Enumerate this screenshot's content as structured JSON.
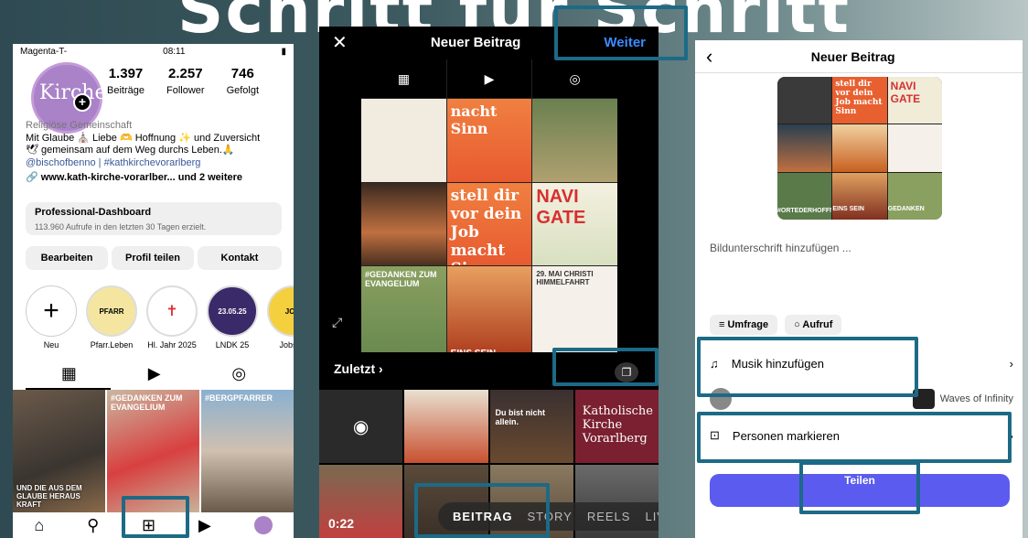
{
  "title": "Schritt für Schritt",
  "colors": {
    "highlight": "#1c6a86",
    "accent": "#3d8bff",
    "share": "#5b5bf0"
  },
  "profile": {
    "status": {
      "carrier": "Magenta-T-",
      "time": "08:11"
    },
    "avatar_text": "Kirche",
    "stats": [
      {
        "value": "1.397",
        "label": "Beiträge"
      },
      {
        "value": "2.257",
        "label": "Follower"
      },
      {
        "value": "746",
        "label": "Gefolgt"
      }
    ],
    "category": "Religiöse Gemeinschaft",
    "bio_line1": "Mit Glaube ⛪ Liebe 🫶 Hoffnung ✨ und Zuversicht",
    "bio_line2": "🕊 gemeinsam auf dem Weg durchs Leben.🙏",
    "mentions": "@bischofbenno | #kathkirchevorarlberg",
    "website": "🔗 www.kath-kirche-vorarlber... und 2 weitere",
    "dashboard_title": "Professional-Dashboard",
    "dashboard_sub": "113.960 Aufrufe in den letzten 30 Tagen erzielt.",
    "buttons": [
      "Bearbeiten",
      "Profil teilen",
      "Kontakt"
    ],
    "highlights": [
      {
        "label": "Neu",
        "text": "+"
      },
      {
        "label": "Pfarr.Leben",
        "text": "PFARR"
      },
      {
        "label": "Hl. Jahr 2025",
        "text": ""
      },
      {
        "label": "LNDK 25",
        "text": "23.05.25"
      },
      {
        "label": "Jobs m",
        "text": "JOB"
      }
    ],
    "grid_captions": [
      "",
      "#GEDANKEN ZUM EVANGELIUM",
      "#BERGPFARRER"
    ],
    "grid_overlay": "UND DIE AUS DEM GLAUBE HERAUS KRAFT"
  },
  "newpost": {
    "close": "✕",
    "title": "Neuer Beitrag",
    "next": "Weiter",
    "tiles": [
      "nacht Sinn",
      "",
      "stell dir vor dein Job macht Sinn",
      "NAVI GATE",
      "#GEDANKEN ZUM EVANGELIUM",
      "29. MAI CHRISTI HIMMELFAHRT",
      "EINS SEIN",
      "GEDANKEN ZUM EVANGELIUM",
      "#ORTEDERHOFFNUNG"
    ],
    "recent": "Zuletzt ›",
    "gallery": [
      "",
      "",
      "Du bist nicht allein.",
      "Katholische Kirche Vorarlberg",
      "",
      "",
      "",
      ""
    ],
    "video_time": "0:22",
    "modes": [
      "BEITRAG",
      "STORY",
      "REELS",
      "LIV"
    ]
  },
  "share": {
    "back": "‹",
    "title": "Neuer Beitrag",
    "caption_placeholder": "Bildunterschrift hinzufügen ...",
    "chips": [
      "≡ Umfrage",
      "○ Aufruf"
    ],
    "music": "Musik hinzufügen",
    "music_track": "Waves of Infinity",
    "tag": "Personen markieren",
    "share_button": "Teilen",
    "thumb_texts": [
      "",
      "stell dir vor dein Job macht Sinn",
      "NAVI GATE",
      "",
      "",
      "EINS SEIN",
      "#ORTEDERHOFFNUNG",
      "",
      "GEDANKEN"
    ]
  }
}
